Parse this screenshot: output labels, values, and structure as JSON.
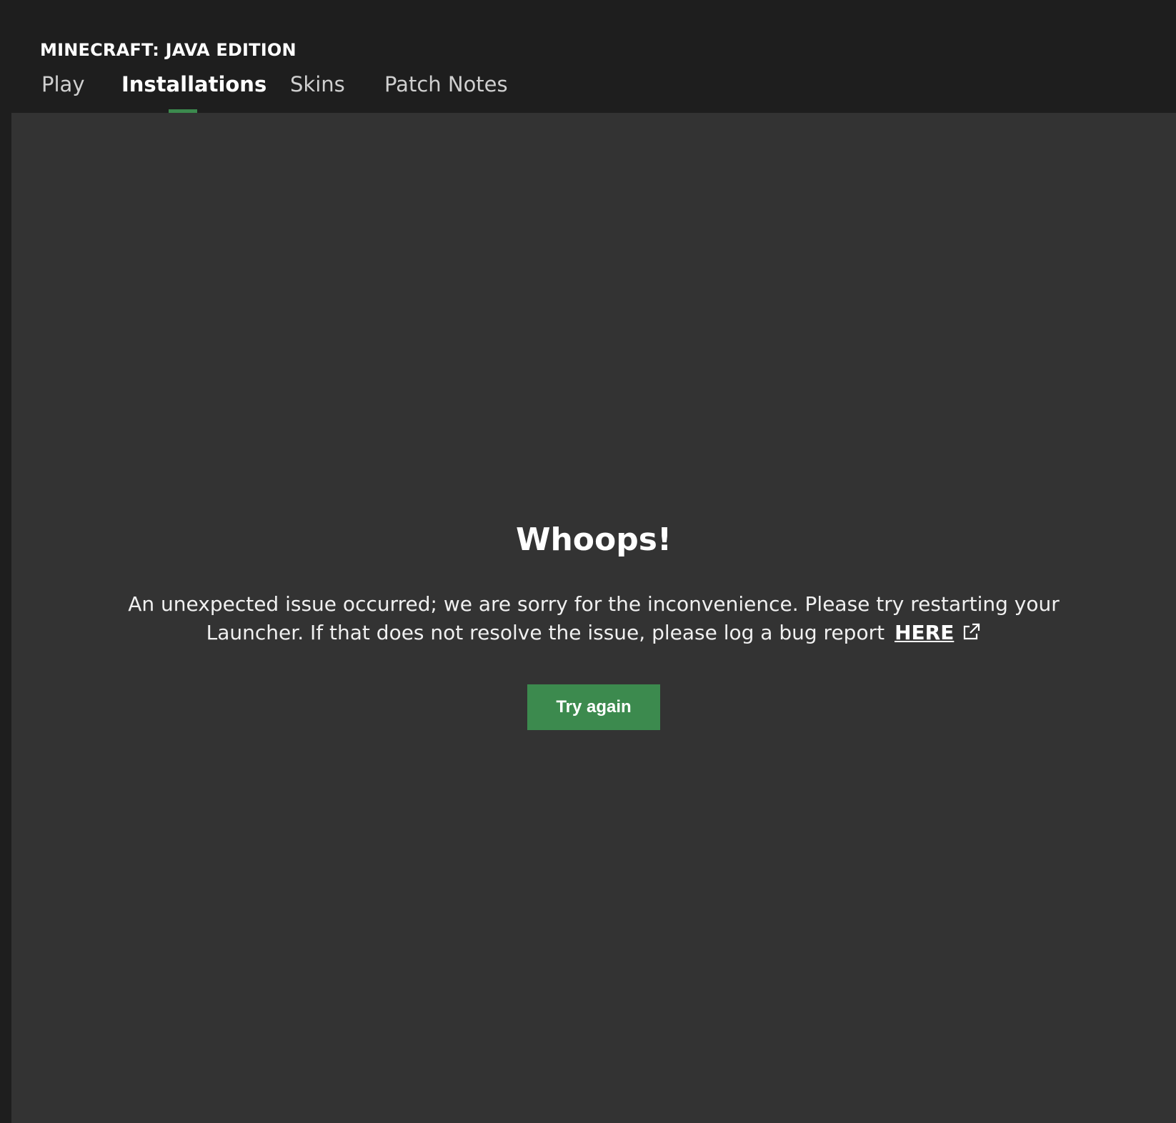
{
  "header": {
    "app_title": "MINECRAFT: JAVA EDITION",
    "tabs": [
      {
        "label": "Play",
        "active": false
      },
      {
        "label": "Installations",
        "active": true
      },
      {
        "label": "Skins",
        "active": false
      },
      {
        "label": "Patch Notes",
        "active": false
      }
    ]
  },
  "error": {
    "title": "Whoops!",
    "message": "An unexpected issue occurred; we are sorry for the inconvenience. Please try restarting your Launcher. If that does not resolve the issue, please log a bug report",
    "link_label": "HERE",
    "link_icon": "external-link-icon",
    "button_label": "Try again"
  },
  "colors": {
    "header_bg": "#1e1e1e",
    "content_bg": "#333333",
    "accent_green": "#3c8a4e",
    "text": "#ffffff"
  }
}
